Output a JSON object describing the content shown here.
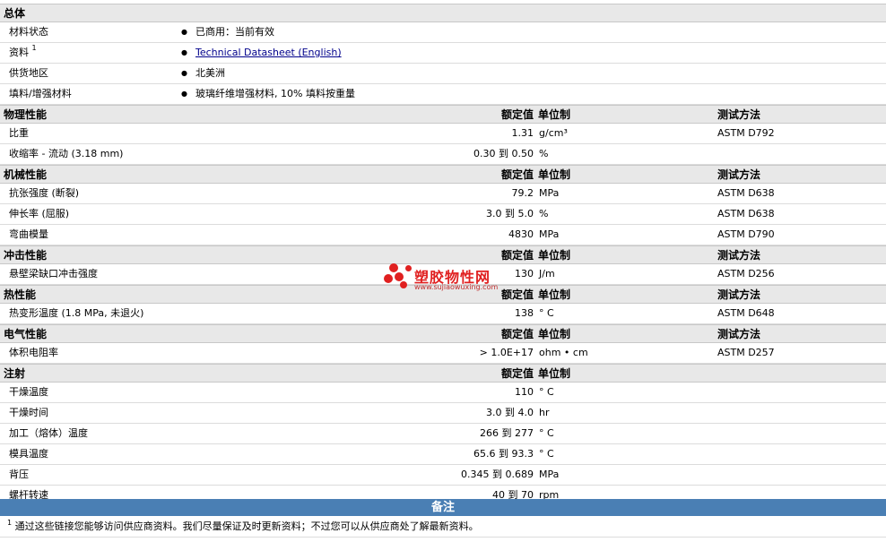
{
  "general": {
    "title": "总体",
    "rows": [
      {
        "label": "材料状态",
        "value": "已商用：当前有效"
      },
      {
        "label": "资料",
        "sup": "1",
        "value": "Technical Datasheet (English)"
      },
      {
        "label": "供货地区",
        "value": "北美洲"
      },
      {
        "label": "填料/增强材料",
        "value": "玻璃纤维增强材料, 10% 填料按重量"
      }
    ]
  },
  "col_headers": {
    "nominal": "额定值",
    "unit": "单位制",
    "method": "测试方法"
  },
  "sections": [
    {
      "title": "物理性能",
      "show_method": true,
      "rows": [
        {
          "label": "比重",
          "value": "1.31",
          "unit": "g/cm³",
          "method": "ASTM D792"
        },
        {
          "label": "收缩率 - 流动 (3.18 mm)",
          "value": "0.30 到 0.50",
          "unit": "%",
          "method": ""
        }
      ]
    },
    {
      "title": "机械性能",
      "show_method": true,
      "rows": [
        {
          "label": "抗张强度 (断裂)",
          "value": "79.2",
          "unit": "MPa",
          "method": "ASTM D638"
        },
        {
          "label": "伸长率 (屈服)",
          "value": "3.0 到 5.0",
          "unit": "%",
          "method": "ASTM D638"
        },
        {
          "label": "弯曲模量",
          "value": "4830",
          "unit": "MPa",
          "method": "ASTM D790"
        }
      ]
    },
    {
      "title": "冲击性能",
      "show_method": true,
      "rows": [
        {
          "label": "悬壁梁缺口冲击强度",
          "value": "130",
          "unit": "J/m",
          "method": "ASTM D256"
        }
      ]
    },
    {
      "title": "热性能",
      "show_method": true,
      "rows": [
        {
          "label": "热变形温度 (1.8 MPa, 未退火)",
          "value": "138",
          "unit": "° C",
          "method": "ASTM D648"
        }
      ]
    },
    {
      "title": "电气性能",
      "show_method": true,
      "rows": [
        {
          "label": "体积电阻率",
          "value": "> 1.0E+17",
          "unit": "ohm • cm",
          "method": "ASTM D257"
        }
      ]
    },
    {
      "title": "注射",
      "show_method": false,
      "rows": [
        {
          "label": "干燥温度",
          "value": "110",
          "unit": "° C",
          "method": ""
        },
        {
          "label": "干燥时间",
          "value": "3.0 到 4.0",
          "unit": "hr",
          "method": ""
        },
        {
          "label": "加工（熔体）温度",
          "value": "266 到 277",
          "unit": "° C",
          "method": ""
        },
        {
          "label": "模具温度",
          "value": "65.6 到 93.3",
          "unit": "° C",
          "method": ""
        },
        {
          "label": "背压",
          "value": "0.345 到 0.689",
          "unit": "MPa",
          "method": ""
        },
        {
          "label": "螺杆转速",
          "value": "40 到 70",
          "unit": "rpm",
          "method": ""
        }
      ]
    }
  ],
  "notes": {
    "title": "备注",
    "footnote_num": "1",
    "footnote": "通过这些链接您能够访问供应商资料。我们尽量保证及时更新资料；不过您可以从供应商处了解最新资料。"
  },
  "watermark": {
    "title": "塑胶物性网",
    "url": "www.sujiaowuxing.com"
  },
  "colors": {
    "header_bg": "#e8e8e8",
    "notes_bar": "#4a7fb4",
    "link": "#00008b",
    "watermark": "#e02020"
  }
}
